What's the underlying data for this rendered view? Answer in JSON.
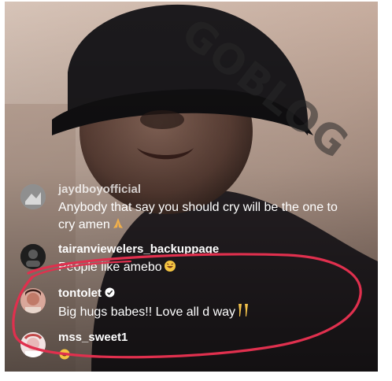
{
  "watermark": "GOBLOG",
  "comments": [
    {
      "username": "jaydboyofficial",
      "text": "Anybody that say you should cry will be the one to cry amen",
      "emoji": "pray-emoji"
    },
    {
      "username": "tairanviewelers_backuppage",
      "text": "People like amebo",
      "emoji": "laughing-emoji"
    },
    {
      "username": "tontolet",
      "verified": true,
      "text": "Big hugs babes!! Love all d way",
      "emoji": "clinking-glasses-emoji"
    },
    {
      "username": "mss_sweet1",
      "text": "",
      "emoji": "laughing-emoji"
    }
  ],
  "colors": {
    "highlight_circle": "#e0304e",
    "text": "#ffffff",
    "verified_badge": "#ffffff"
  }
}
